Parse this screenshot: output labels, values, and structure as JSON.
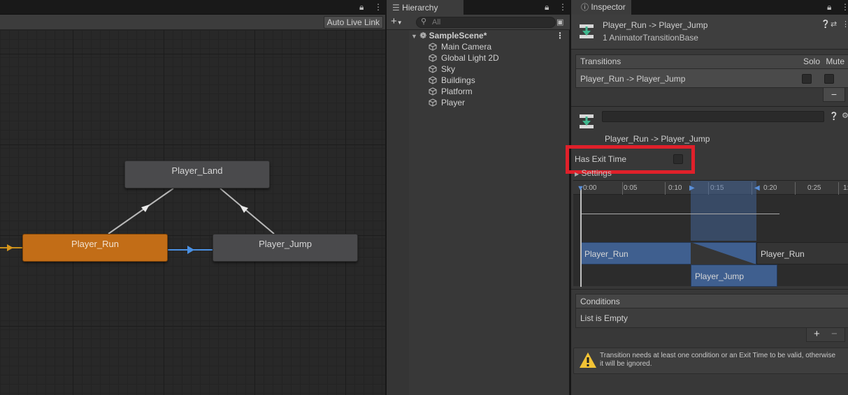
{
  "animator": {
    "toolbar": {
      "auto_live_link": "Auto Live Link"
    },
    "states": [
      {
        "name": "Player_Land",
        "color": "#4a4a4c",
        "active": false
      },
      {
        "name": "Player_Run",
        "color": "#c26d17",
        "active": true
      },
      {
        "name": "Player_Jump",
        "color": "#4a4a4c",
        "active": false
      }
    ],
    "selected_transition_color": "#4a90e2"
  },
  "hierarchy": {
    "tab_label": "Hierarchy",
    "search_placeholder": "All",
    "scene": "SampleScene*",
    "objects": [
      "Main Camera",
      "Global Light 2D",
      "Sky",
      "Buildings",
      "Platform",
      "Player"
    ]
  },
  "inspector": {
    "tab_label": "Inspector",
    "header": {
      "title": "Player_Run -> Player_Jump",
      "subtitle": "1 AnimatorTransitionBase"
    },
    "transitions": {
      "header": "Transitions",
      "solo_label": "Solo",
      "mute_label": "Mute",
      "rows": [
        {
          "name": "Player_Run -> Player_Jump",
          "solo": false,
          "mute": false
        }
      ],
      "remove_label": "−"
    },
    "transition_detail": {
      "name_field": "",
      "title": "Player_Run -> Player_Jump",
      "has_exit_time_label": "Has Exit Time",
      "has_exit_time": false,
      "settings_label": "Settings"
    },
    "timeline": {
      "ticks": [
        "0:00",
        "0:05",
        "0:10",
        "0:15",
        "0:20",
        "0:25",
        "1:"
      ],
      "source_clip": "Player_Run",
      "source_clip_repeat": "Player_Run",
      "dest_clip": "Player_Jump"
    },
    "conditions": {
      "header": "Conditions",
      "empty_text": "List is Empty",
      "add_label": "+",
      "remove_label": "−"
    },
    "warning": "Transition needs at least one condition or an Exit Time to be valid, otherwise it will be ignored."
  }
}
